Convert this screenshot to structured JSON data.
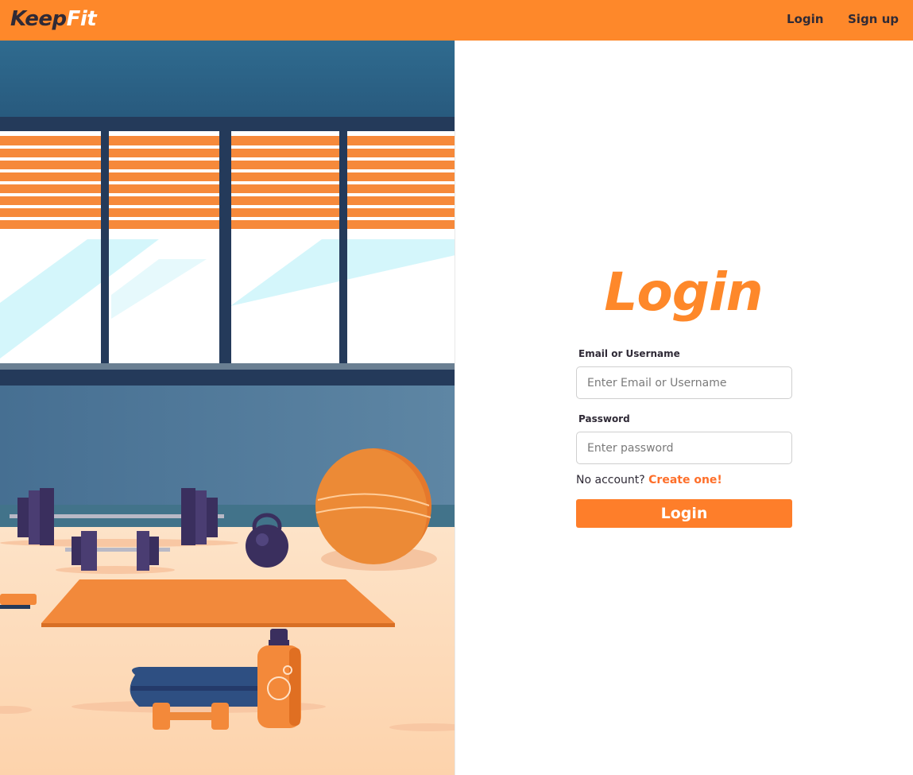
{
  "brand": {
    "part1": "Keep",
    "part2": "Fit"
  },
  "nav": {
    "login_label": "Login",
    "signup_label": "Sign up"
  },
  "login_form": {
    "title": "Login",
    "email_label": "Email or Username",
    "email_placeholder": "Enter Email or Username",
    "password_label": "Password",
    "password_placeholder": "Enter password",
    "no_account_text": "No account?",
    "create_link": "Create one!",
    "submit_label": "Login"
  },
  "colors": {
    "brand_orange": "#fe882a",
    "dark_text": "#2f2a36",
    "button_orange": "#fe7e2a",
    "link_orange": "#fe6f2a"
  },
  "icons": [
    "gym-illustration"
  ]
}
